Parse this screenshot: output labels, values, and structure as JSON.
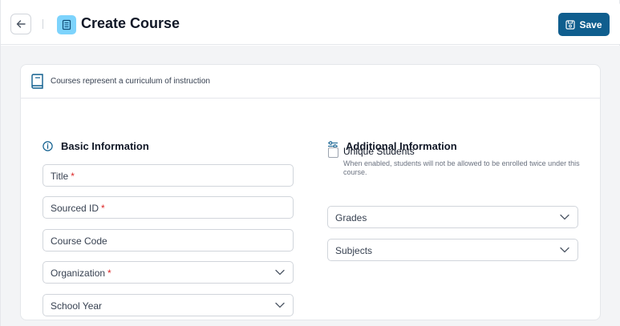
{
  "header": {
    "title": "Create Course",
    "save_label": "Save"
  },
  "card": {
    "description": "Courses represent a curriculum of instruction"
  },
  "basic": {
    "title": "Basic Information",
    "fields": [
      {
        "label": "Title",
        "required": "*"
      },
      {
        "label": "Sourced ID",
        "required": "*"
      },
      {
        "label": "Course Code",
        "required": ""
      },
      {
        "label": "Organization",
        "required": "*"
      },
      {
        "label": "School Year",
        "required": ""
      }
    ]
  },
  "additional": {
    "title": "Additional Information",
    "unique_label": "Unique Students",
    "unique_help": "When enabled, students will not be allowed to be enrolled twice under this course.",
    "fields": [
      {
        "label": "Grades"
      },
      {
        "label": "Subjects"
      }
    ]
  },
  "colors": {
    "primary": "#0f5e8e",
    "accent_icon_bg": "#7dd3fc",
    "required": "#dc2626"
  }
}
